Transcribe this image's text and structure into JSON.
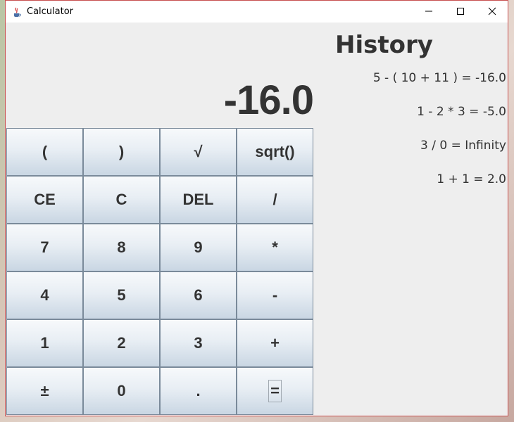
{
  "window": {
    "title": "Calculator",
    "app_icon": "java-coffee-icon",
    "controls": [
      "minimize-icon",
      "maximize-icon",
      "close-icon"
    ]
  },
  "display": {
    "value": "-16.0"
  },
  "keypad": {
    "rows": [
      [
        "(",
        ")",
        "√",
        "sqrt()"
      ],
      [
        "CE",
        "C",
        "DEL",
        "/"
      ],
      [
        "7",
        "8",
        "9",
        "*"
      ],
      [
        "4",
        "5",
        "6",
        "-"
      ],
      [
        "1",
        "2",
        "3",
        "+"
      ],
      [
        "±",
        "0",
        ".",
        "="
      ]
    ],
    "focused_key": "="
  },
  "history": {
    "title": "History",
    "items": [
      "5 - ( 10 + 11 ) = -16.0",
      "1 - 2 * 3 = -5.0",
      "3 / 0 = Infinity",
      "1 + 1 = 2.0"
    ]
  },
  "colors": {
    "border_accent": "#c85050",
    "text": "#333333",
    "panel_bg": "#eeeeee"
  }
}
